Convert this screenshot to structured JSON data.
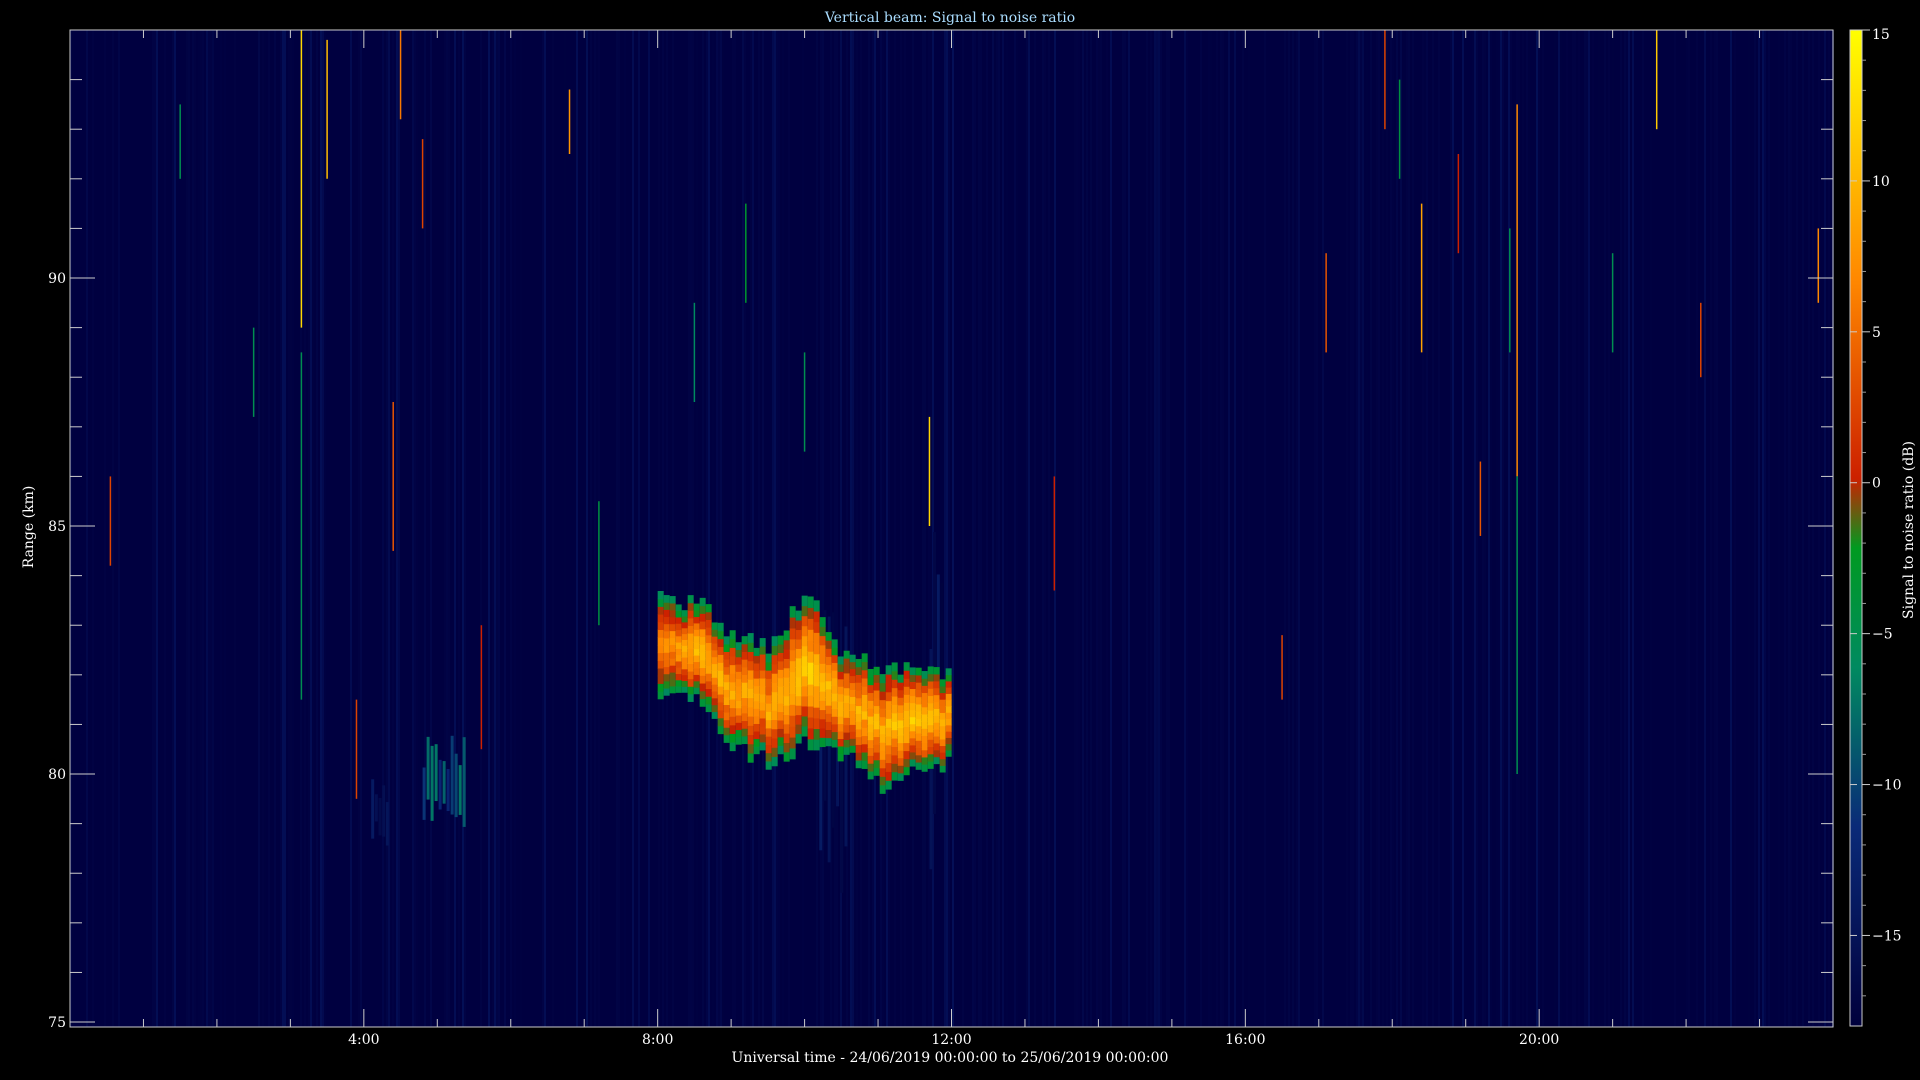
{
  "chart_data": {
    "type": "heatmap",
    "title": "Vertical beam: Signal to noise ratio",
    "xlabel": "Universal time - 24/06/2019 00:00:00 to 25/06/2019 00:00:00",
    "ylabel": "Range (km)",
    "colorbar_label": "Signal to noise ratio (dB)",
    "x_unit": "hours UT",
    "xlim": [
      0,
      24
    ],
    "ylim": [
      74.9,
      95
    ],
    "clim": [
      -18,
      15
    ],
    "x_ticks": [
      4,
      8,
      12,
      16,
      20
    ],
    "x_tick_labels": [
      "4:00",
      "8:00",
      "12:00",
      "16:00",
      "20:00"
    ],
    "y_ticks": [
      75,
      80,
      85,
      90
    ],
    "y_tick_labels": [
      "75",
      "80",
      "85",
      "90"
    ],
    "colorbar_ticks": [
      15,
      10,
      5,
      0,
      -5,
      -10,
      -15
    ],
    "colorbar_tick_labels": [
      "15",
      "10",
      "5",
      "0",
      "−5",
      "−10",
      "−15"
    ],
    "colormap": [
      "#00003c",
      "#0a2a78",
      "#008a60",
      "#009a20",
      "#cc2000",
      "#ff8800",
      "#ffff00"
    ],
    "background_color": "#000046",
    "grid": false,
    "echo_layer": {
      "description": "layer",
      "time_start": 8.0,
      "time_end": 12.0,
      "range_profile": [
        {
          "t": 8.0,
          "lo": 81.5,
          "hi": 83.5,
          "peak_db": 6
        },
        {
          "t": 8.5,
          "lo": 81.6,
          "hi": 83.5,
          "peak_db": 10
        },
        {
          "t": 9.0,
          "lo": 80.6,
          "hi": 82.8,
          "peak_db": 9
        },
        {
          "t": 9.5,
          "lo": 80.2,
          "hi": 82.6,
          "peak_db": 9
        },
        {
          "t": 10.0,
          "lo": 80.6,
          "hi": 83.6,
          "peak_db": 12
        },
        {
          "t": 10.5,
          "lo": 80.4,
          "hi": 82.4,
          "peak_db": 9
        },
        {
          "t": 11.0,
          "lo": 79.8,
          "hi": 82.2,
          "peak_db": 10
        },
        {
          "t": 11.5,
          "lo": 80.0,
          "hi": 82.2,
          "peak_db": 12
        },
        {
          "t": 11.9,
          "lo": 80.2,
          "hi": 82.0,
          "peak_db": 9
        }
      ]
    },
    "weak_patches": [
      {
        "t0": 4.1,
        "t1": 4.35,
        "lo": 78.5,
        "hi": 80.0,
        "peak_db": -12
      },
      {
        "t0": 4.8,
        "t1": 5.4,
        "lo": 78.8,
        "hi": 80.8,
        "peak_db": -8
      },
      {
        "t0": 10.2,
        "t1": 10.6,
        "lo": 77.5,
        "hi": 84.0,
        "peak_db": -13
      },
      {
        "t0": 11.7,
        "t1": 11.9,
        "lo": 77.5,
        "hi": 85.5,
        "peak_db": -13
      }
    ],
    "spikes": [
      {
        "t": 3.15,
        "lo": 89.0,
        "hi": 95.0,
        "db": 12
      },
      {
        "t": 3.15,
        "lo": 81.5,
        "hi": 88.5,
        "db": -6
      },
      {
        "t": 3.5,
        "lo": 92.0,
        "hi": 94.8,
        "db": 10
      },
      {
        "t": 4.5,
        "lo": 93.2,
        "hi": 95.0,
        "db": 5
      },
      {
        "t": 4.8,
        "lo": 91.0,
        "hi": 92.8,
        "db": 2
      },
      {
        "t": 6.8,
        "lo": 92.5,
        "hi": 93.8,
        "db": 7
      },
      {
        "t": 4.4,
        "lo": 84.5,
        "hi": 87.5,
        "db": 3
      },
      {
        "t": 3.9,
        "lo": 79.5,
        "hi": 81.5,
        "db": 2
      },
      {
        "t": 7.2,
        "lo": 83.0,
        "hi": 85.5,
        "db": -5
      },
      {
        "t": 5.6,
        "lo": 80.5,
        "hi": 83.0,
        "db": 0
      },
      {
        "t": 8.5,
        "lo": 87.5,
        "hi": 89.5,
        "db": -7
      },
      {
        "t": 9.2,
        "lo": 89.5,
        "hi": 91.5,
        "db": -4
      },
      {
        "t": 10.0,
        "lo": 86.5,
        "hi": 88.5,
        "db": -6
      },
      {
        "t": 11.7,
        "lo": 85.0,
        "hi": 87.2,
        "db": 12
      },
      {
        "t": 13.4,
        "lo": 83.7,
        "hi": 86.0,
        "db": 0
      },
      {
        "t": 16.5,
        "lo": 81.5,
        "hi": 82.8,
        "db": 2
      },
      {
        "t": 17.1,
        "lo": 88.5,
        "hi": 90.5,
        "db": 3
      },
      {
        "t": 17.9,
        "lo": 93.0,
        "hi": 95.0,
        "db": 2
      },
      {
        "t": 18.1,
        "lo": 92.0,
        "hi": 94.0,
        "db": -5
      },
      {
        "t": 18.4,
        "lo": 88.5,
        "hi": 91.5,
        "db": 8
      },
      {
        "t": 18.9,
        "lo": 90.5,
        "hi": 92.5,
        "db": 0
      },
      {
        "t": 19.2,
        "lo": 84.8,
        "hi": 86.3,
        "db": 3
      },
      {
        "t": 19.7,
        "lo": 86.0,
        "hi": 93.5,
        "db": 6
      },
      {
        "t": 19.7,
        "lo": 80.0,
        "hi": 86.0,
        "db": -6
      },
      {
        "t": 21.6,
        "lo": 93.0,
        "hi": 95.0,
        "db": 11
      },
      {
        "t": 22.2,
        "lo": 88.0,
        "hi": 89.5,
        "db": 2
      },
      {
        "t": 23.8,
        "lo": 89.5,
        "hi": 91.0,
        "db": 6
      },
      {
        "t": 19.6,
        "lo": 88.5,
        "hi": 91.0,
        "db": -6
      },
      {
        "t": 21.0,
        "lo": 88.5,
        "hi": 90.5,
        "db": -6
      },
      {
        "t": 1.5,
        "lo": 92.0,
        "hi": 93.5,
        "db": -6
      },
      {
        "t": 0.55,
        "lo": 84.2,
        "hi": 86.0,
        "db": 2
      },
      {
        "t": 2.5,
        "lo": 87.2,
        "hi": 89.0,
        "db": -6
      }
    ]
  }
}
